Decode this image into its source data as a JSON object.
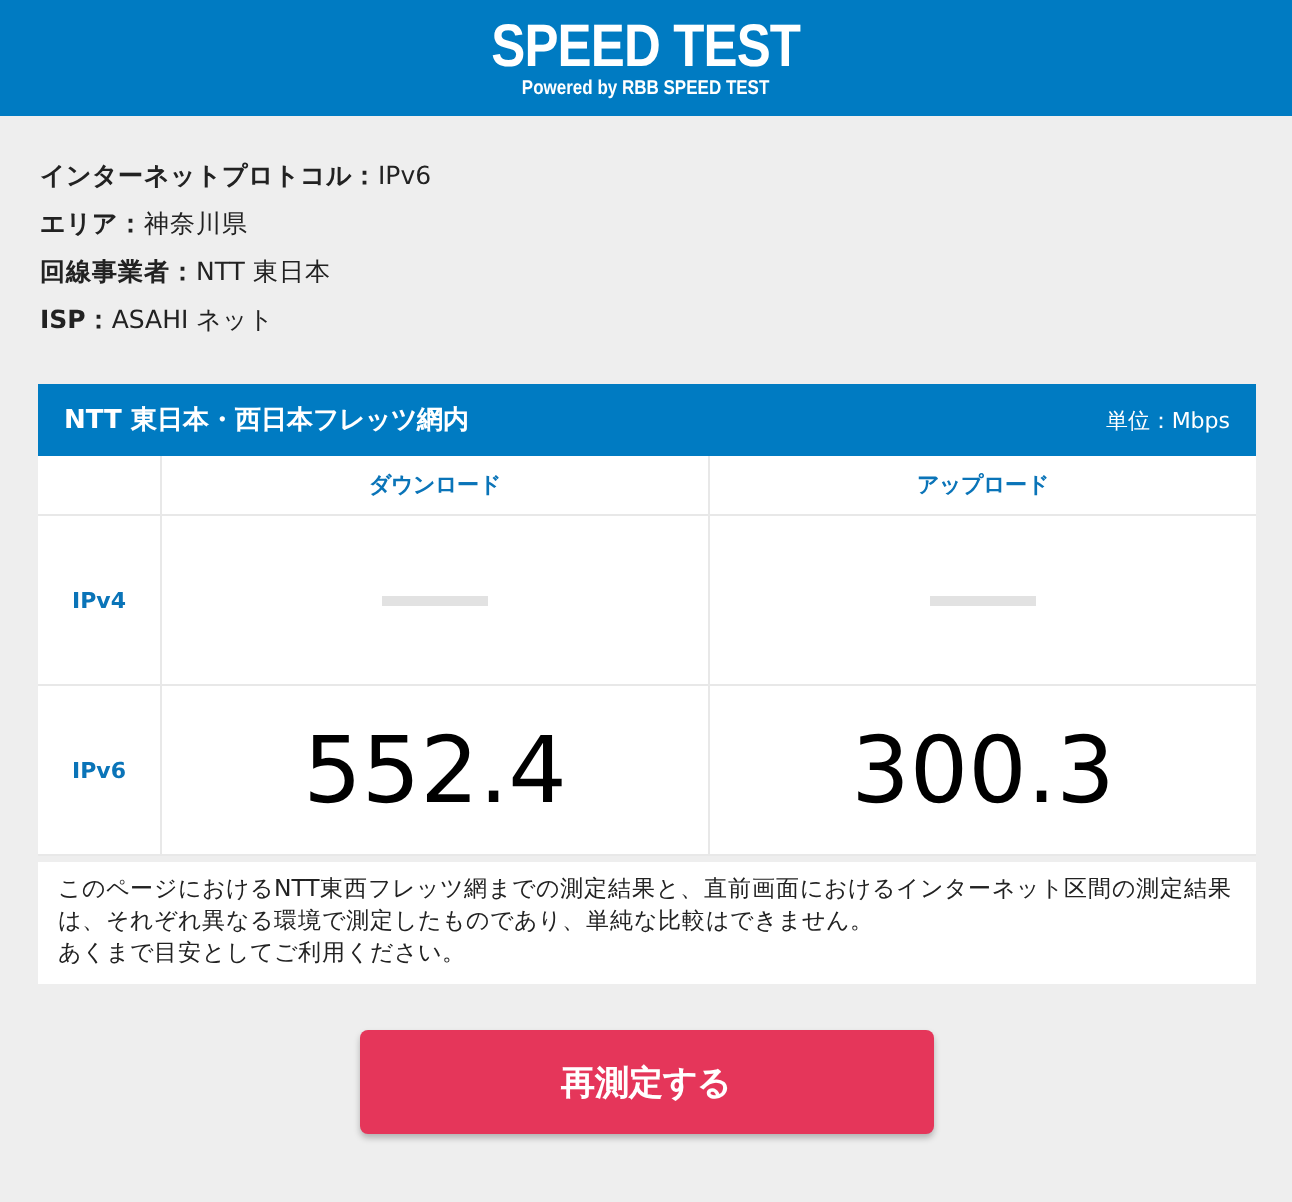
{
  "header": {
    "title": "SPEED TEST",
    "subtitle": "Powered by RBB SPEED TEST"
  },
  "info": [
    {
      "label": "インターネットプロトコル：",
      "value": "IPv6"
    },
    {
      "label": "エリア：",
      "value": "神奈川県"
    },
    {
      "label": "回線事業者：",
      "value": "NTT 東日本"
    },
    {
      "label": "ISP：",
      "value": "ASAHI ネット"
    }
  ],
  "table": {
    "title": "NTT 東日本・西日本フレッツ網内",
    "unit": "単位：Mbps",
    "columns": [
      "ダウンロード",
      "アップロード"
    ],
    "rows": [
      {
        "label": "IPv4",
        "cells": [
          {
            "kind": "empty"
          },
          {
            "kind": "empty"
          }
        ]
      },
      {
        "label": "IPv6",
        "cells": [
          {
            "kind": "value",
            "value": "552.4"
          },
          {
            "kind": "value",
            "value": "300.3"
          }
        ]
      }
    ]
  },
  "note": [
    "このページにおけるNTT東西フレッツ網までの測定結果と、直前画面におけるインターネット区間の測定結果は、それぞれ異なる環境で測定したものであり、単純な比較はできません。",
    "あくまで目安としてご利用ください。"
  ],
  "button": "再測定する"
}
